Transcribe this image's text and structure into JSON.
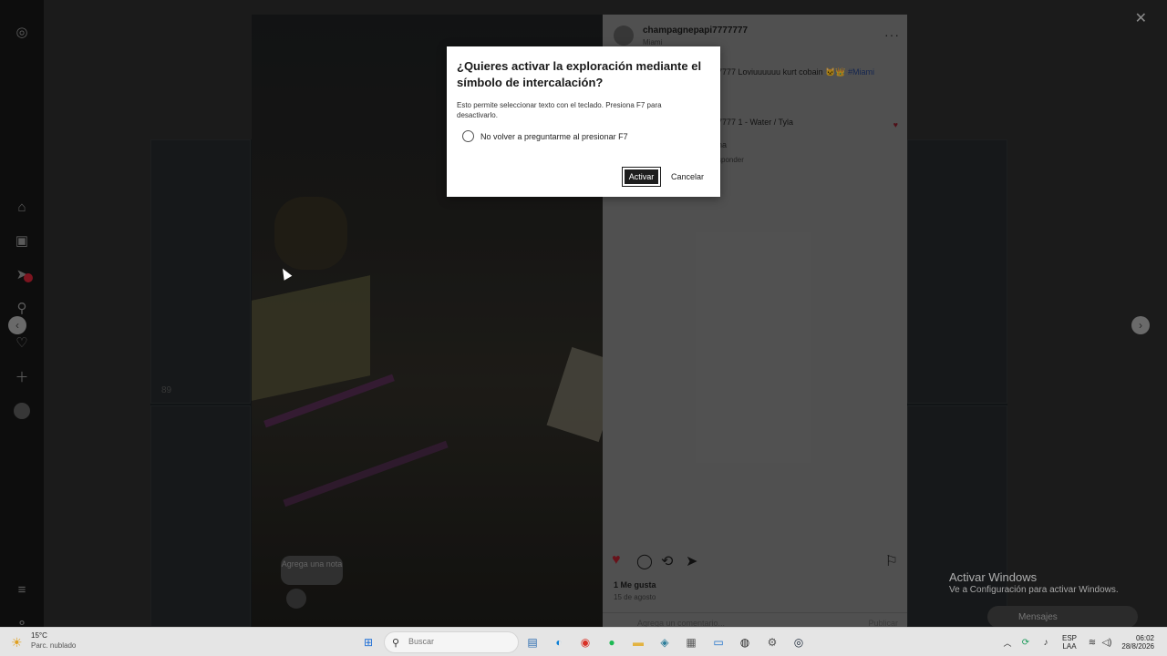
{
  "dialog": {
    "title": "¿Quieres activar la exploración mediante el símbolo de intercalación?",
    "description": "Esto permite seleccionar texto con el teclado. Presiona F7 para desactivarlo.",
    "checkbox_label": "No volver a preguntarme al presionar F7",
    "checkbox_checked": false,
    "activate_label": "Activar",
    "cancel_label": "Cancelar"
  },
  "post": {
    "username": "champagnepapi7777777",
    "location": "Miami",
    "caption_visible": "7777 Loviuuuuuu kurt cobain",
    "caption_emojis": "🐱👑",
    "caption_tag": "#Miami",
    "comment_visible": "7777 1 - Water / Tyla",
    "comment_sub": "na",
    "comment_reply": "sponder",
    "likes": "1 Me gusta",
    "date": "15 de agosto",
    "comment_placeholder": "Agrega un comentario...",
    "publish_label": "Publicar",
    "note_text": "Agrega una nota",
    "views": "89"
  },
  "watermark": {
    "title": "Activar Windows",
    "subtitle": "Ve a Configuración para activar Windows."
  },
  "messages_label": "Mensajes",
  "taskbar": {
    "weather_temp": "15°C",
    "weather_cond": "Parc. nublado",
    "search_placeholder": "Buscar",
    "lang_top": "ESP",
    "lang_bottom": "LAA",
    "time": "06:02",
    "date": "28/8/2026"
  },
  "colors": {
    "dialog_bg": "#ffffff",
    "activate_btn": "#1d1d1d",
    "like_heart": "#c0202e",
    "taskbar_bg": "#e5e5e5"
  }
}
